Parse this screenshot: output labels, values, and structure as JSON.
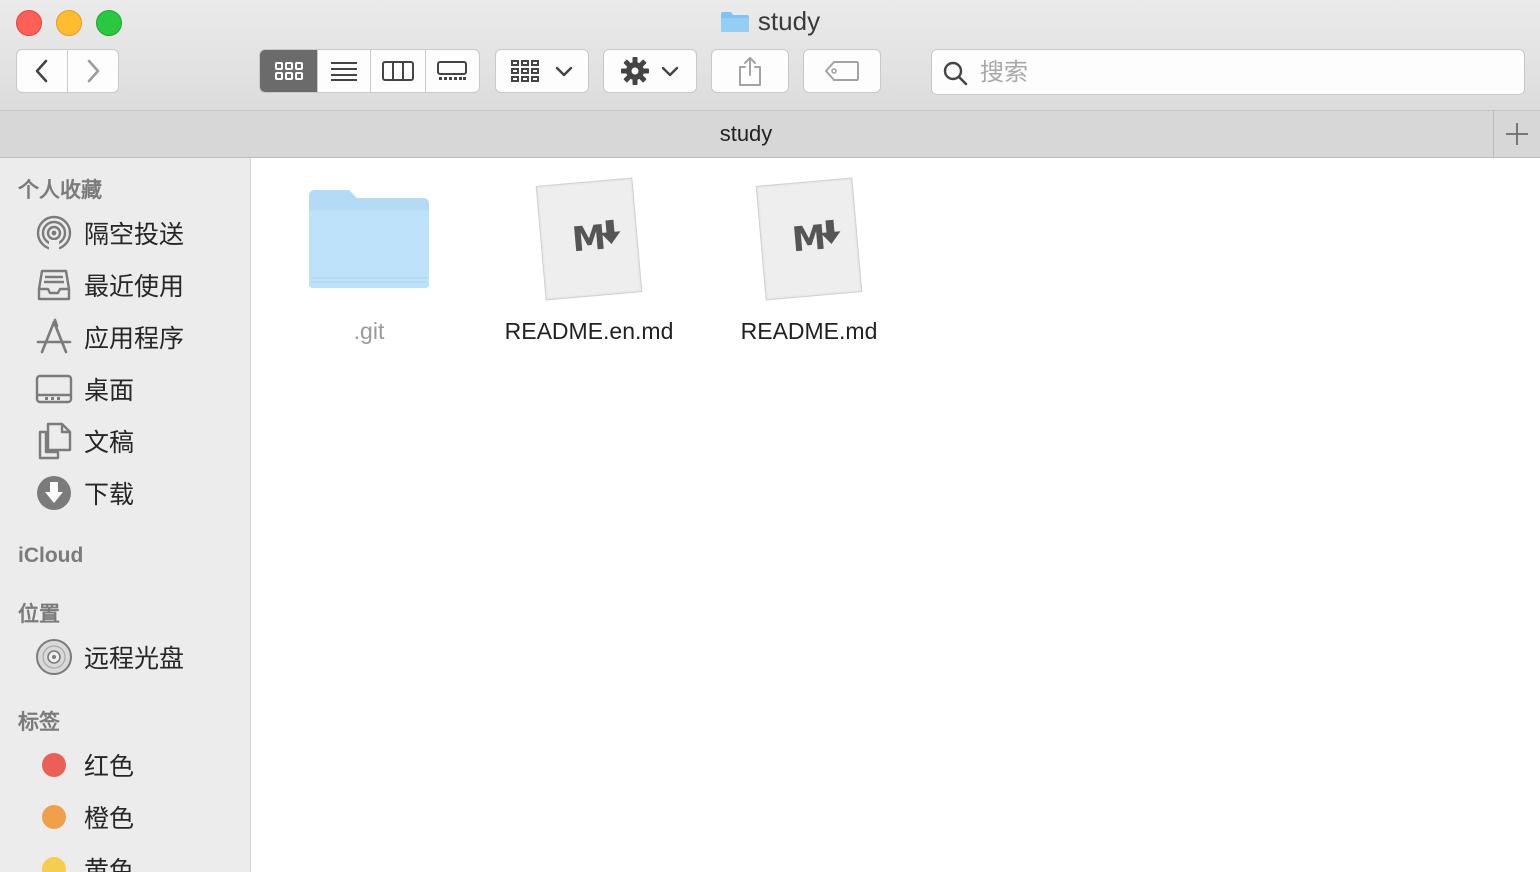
{
  "window": {
    "title": "study"
  },
  "toolbar": {
    "search_placeholder": "搜索"
  },
  "pathbar": {
    "title": "study"
  },
  "sidebar": {
    "sections": [
      {
        "label": "个人收藏"
      },
      {
        "label": "iCloud"
      },
      {
        "label": "位置"
      },
      {
        "label": "标签"
      }
    ],
    "favorites": [
      {
        "label": "隔空投送",
        "icon": "airdrop-icon"
      },
      {
        "label": "最近使用",
        "icon": "recents-icon"
      },
      {
        "label": "应用程序",
        "icon": "applications-icon"
      },
      {
        "label": "桌面",
        "icon": "desktop-icon"
      },
      {
        "label": "文稿",
        "icon": "documents-icon"
      },
      {
        "label": "下载",
        "icon": "downloads-icon"
      }
    ],
    "locations": [
      {
        "label": "远程光盘",
        "icon": "disc-icon"
      }
    ],
    "tags": [
      {
        "label": "红色",
        "color": "#ec5f57"
      },
      {
        "label": "橙色",
        "color": "#f0a04b"
      },
      {
        "label": "黄色",
        "color": "#f5cd4f"
      }
    ]
  },
  "files": [
    {
      "name": ".git",
      "type": "folder",
      "hidden": true
    },
    {
      "name": "README.en.md",
      "type": "markdown"
    },
    {
      "name": "README.md",
      "type": "markdown"
    }
  ],
  "colors": {
    "folder": "#a9d7f7",
    "active_segment": "#6b6b6b"
  }
}
